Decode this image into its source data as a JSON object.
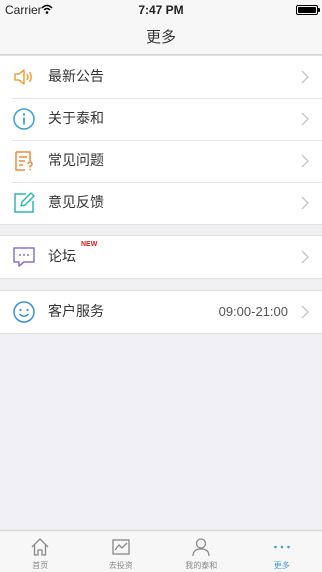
{
  "status_bar": {
    "carrier": "Carrier",
    "time": "7:47 PM"
  },
  "nav": {
    "title": "更多"
  },
  "menu_groups": [
    [
      {
        "label": "最新公告",
        "icon": "speaker-icon"
      },
      {
        "label": "关于泰和",
        "icon": "info-icon"
      },
      {
        "label": "常见问题",
        "icon": "faq-icon"
      },
      {
        "label": "意见反馈",
        "icon": "edit-icon"
      }
    ],
    [
      {
        "label": "论坛",
        "icon": "chat-icon",
        "badge": "NEW"
      }
    ],
    [
      {
        "label": "客户服务",
        "icon": "smile-icon",
        "value": "09:00-21:00"
      }
    ]
  ],
  "tabs": [
    {
      "label": "首页",
      "icon": "home-icon",
      "active": false
    },
    {
      "label": "去投资",
      "icon": "invest-icon",
      "active": false
    },
    {
      "label": "我的泰和",
      "icon": "user-icon",
      "active": false
    },
    {
      "label": "更多",
      "icon": "more-icon",
      "active": true
    }
  ],
  "colors": {
    "accent": "#3aa0d8",
    "badge": "#e02020",
    "speaker": "#f0a23a",
    "info": "#3aa0d8",
    "faq": "#f08a3a",
    "edit": "#2bbcb0",
    "chat": "#8a6fd0",
    "smile": "#3a8fd8"
  }
}
